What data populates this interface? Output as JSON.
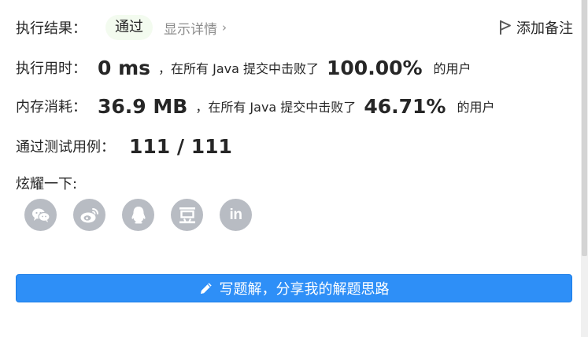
{
  "result": {
    "label": "执行结果：",
    "status": "通过",
    "details_link": "显示详情",
    "note_button": "添加备注"
  },
  "runtime": {
    "label": "执行用时：",
    "value": "0 ms",
    "text_prefix": "，在所有 Java 提交中击败了",
    "percent": "100.00%",
    "text_suffix": "的用户"
  },
  "memory": {
    "label": "内存消耗：",
    "value": "36.9 MB",
    "text_prefix": "，在所有 Java 提交中击败了",
    "percent": "46.71%",
    "text_suffix": "的用户"
  },
  "tests": {
    "label": "通过测试用例：",
    "value": "111 / 111"
  },
  "share": {
    "label": "炫耀一下:",
    "icons": [
      "wechat-icon",
      "weibo-icon",
      "qq-icon",
      "douban-icon",
      "linkedin-icon"
    ],
    "linkedin_text": "in"
  },
  "write_button": {
    "label": "写题解，分享我的解题思路"
  },
  "colors": {
    "accent": "#2e8ff7",
    "status_bg": "#f3fbef",
    "icon_bg": "#b8bcc3"
  }
}
